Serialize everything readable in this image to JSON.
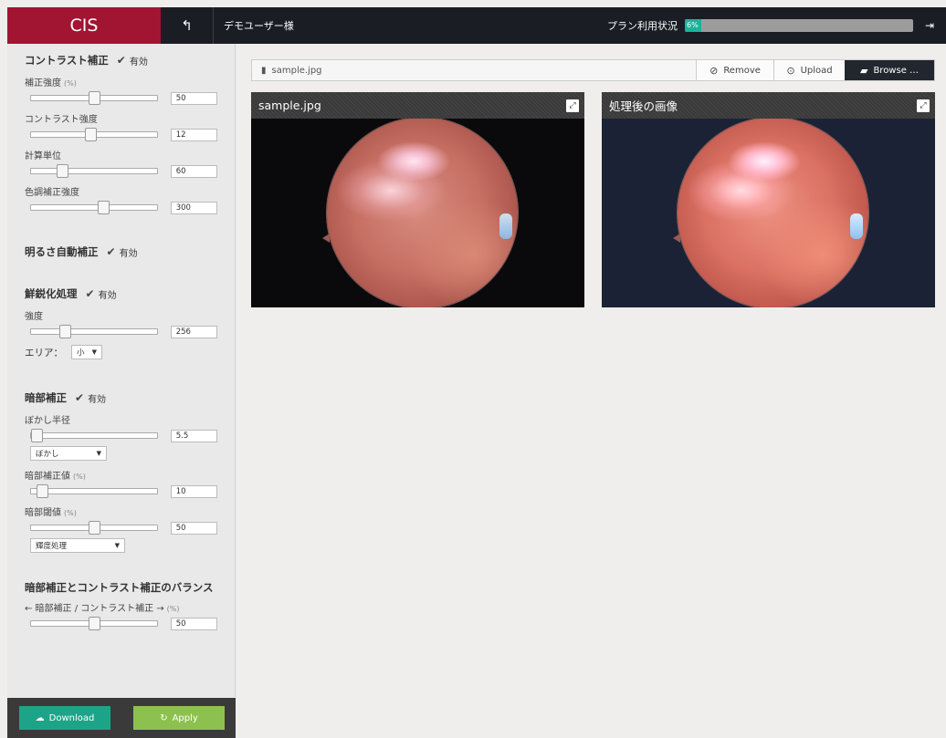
{
  "header": {
    "brand": "CIS",
    "back_icon": "undo-arrow-icon",
    "user_name": "デモユーザー様",
    "plan_label": "プラン利用状況",
    "plan_usage_text": "6%",
    "plan_usage_fraction": 0.06,
    "logout_icon": "sign-out-icon"
  },
  "sidebar": {
    "contrast": {
      "title": "コントラスト補正",
      "enabled_label": "有効",
      "params": [
        {
          "label": "補正強度",
          "unit": "(%)",
          "value": "50",
          "fraction": 0.5
        },
        {
          "label": "コントラスト強度",
          "unit": "",
          "value": "12",
          "fraction": 0.47
        },
        {
          "label": "計算単位",
          "unit": "",
          "value": "60",
          "fraction": 0.22
        },
        {
          "label": "色調補正強度",
          "unit": "",
          "value": "300",
          "fraction": 0.58
        }
      ]
    },
    "brightness": {
      "title": "明るさ自動補正",
      "enabled_label": "有効"
    },
    "sharpen": {
      "title": "鮮鋭化処理",
      "enabled_label": "有効",
      "strength": {
        "label": "強度",
        "value": "256",
        "fraction": 0.25
      },
      "area_label": "エリア：",
      "area_value": "小"
    },
    "dark": {
      "title": "暗部補正",
      "enabled_label": "有効",
      "blur": {
        "label": "ぼかし半径",
        "value": "5.5",
        "fraction": 0.0
      },
      "blur_mode": "ぼかし",
      "dark_value": {
        "label": "暗部補正値",
        "unit": "(%)",
        "value": "10",
        "fraction": 0.05
      },
      "dark_threshold": {
        "label": "暗部閾値",
        "unit": "(%)",
        "value": "50",
        "fraction": 0.5
      },
      "threshold_mode": "輝度処理"
    },
    "balance": {
      "title": "暗部補正とコントラスト補正のバランス",
      "label": "← 暗部補正 / コントラスト補正 →",
      "unit": "(%)",
      "value": "50",
      "fraction": 0.5
    },
    "footer": {
      "download_label": "Download",
      "apply_label": "Apply"
    }
  },
  "main": {
    "file_name": "sample.jpg",
    "remove_label": "Remove",
    "upload_label": "Upload",
    "browse_label": "Browse …",
    "original_title": "sample.jpg",
    "processed_title": "処理後の画像"
  }
}
